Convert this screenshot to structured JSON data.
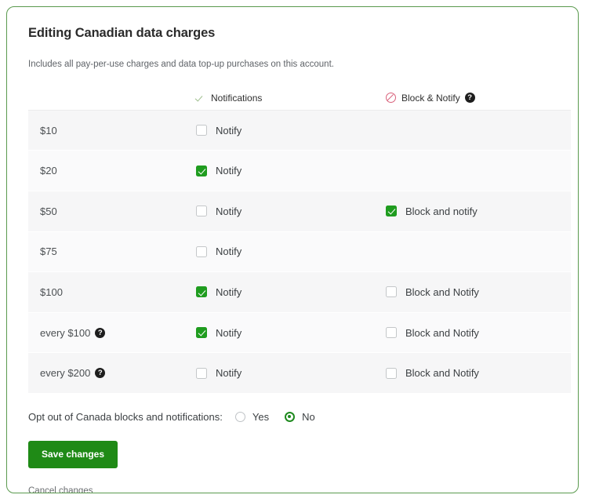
{
  "page": {
    "title": "Editing Canadian data charges",
    "subtitle": "Includes all pay-per-use charges and data top-up purchases on this account."
  },
  "colors": {
    "accent_green": "#1f9c1f",
    "button_green": "#1f8a16",
    "block_red": "#d9607a",
    "frame_border": "#5a9a4e",
    "row_bg_a": "#f6f6f7",
    "row_bg_b": "#fafafb"
  },
  "table": {
    "headers": {
      "amount": "",
      "notifications": "Notifications",
      "block_notify": "Block & Notify",
      "block_notify_help": "?"
    },
    "rows": [
      {
        "amount": "$10",
        "amount_help": null,
        "notify": {
          "label": "Notify",
          "checked": false,
          "visible": true
        },
        "block": {
          "label": "",
          "checked": false,
          "visible": false
        }
      },
      {
        "amount": "$20",
        "amount_help": null,
        "notify": {
          "label": "Notify",
          "checked": true,
          "visible": true
        },
        "block": {
          "label": "",
          "checked": false,
          "visible": false
        }
      },
      {
        "amount": "$50",
        "amount_help": null,
        "notify": {
          "label": "Notify",
          "checked": false,
          "visible": true
        },
        "block": {
          "label": "Block and notify",
          "checked": true,
          "visible": true
        }
      },
      {
        "amount": "$75",
        "amount_help": null,
        "notify": {
          "label": "Notify",
          "checked": false,
          "visible": true
        },
        "block": {
          "label": "",
          "checked": false,
          "visible": false
        }
      },
      {
        "amount": "$100",
        "amount_help": null,
        "notify": {
          "label": "Notify",
          "checked": true,
          "visible": true
        },
        "block": {
          "label": "Block and Notify",
          "checked": false,
          "visible": true
        }
      },
      {
        "amount": "every $100",
        "amount_help": "?",
        "notify": {
          "label": "Notify",
          "checked": true,
          "visible": true
        },
        "block": {
          "label": "Block and Notify",
          "checked": false,
          "visible": true
        }
      },
      {
        "amount": "every $200",
        "amount_help": "?",
        "notify": {
          "label": "Notify",
          "checked": false,
          "visible": true
        },
        "block": {
          "label": "Block and Notify",
          "checked": false,
          "visible": true
        }
      }
    ]
  },
  "optout": {
    "label": "Opt out of Canada blocks and notifications:",
    "options": [
      {
        "label": "Yes",
        "selected": false
      },
      {
        "label": "No",
        "selected": true
      }
    ]
  },
  "actions": {
    "save_label": "Save changes",
    "cancel_label": "Cancel changes"
  }
}
